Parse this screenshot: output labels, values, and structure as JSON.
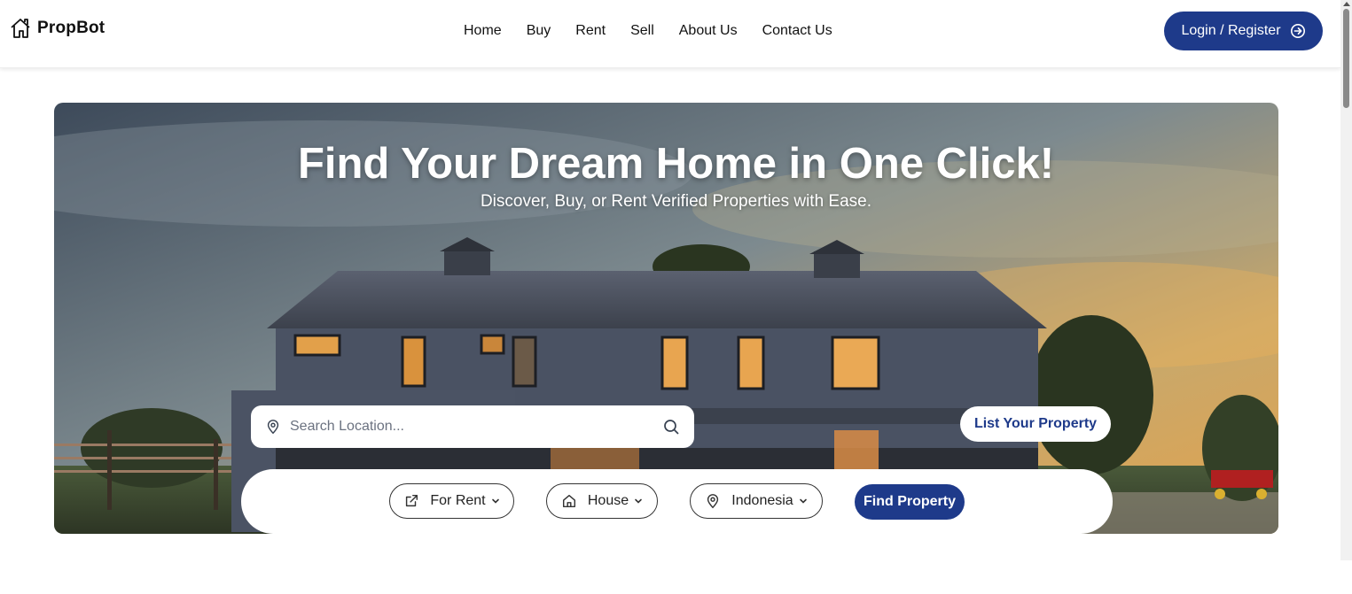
{
  "brand": {
    "name": "PropBot",
    "icon": "house-outline-icon"
  },
  "nav": {
    "items": [
      {
        "label": "Home"
      },
      {
        "label": "Buy"
      },
      {
        "label": "Rent"
      },
      {
        "label": "Sell"
      },
      {
        "label": "About Us"
      },
      {
        "label": "Contact Us"
      }
    ]
  },
  "auth": {
    "login_label": "Login / Register",
    "icon": "arrow-circle-right-icon"
  },
  "hero": {
    "title": "Find Your Dream Home in One Click!",
    "subtitle": "Discover, Buy, or Rent Verified Properties with Ease."
  },
  "search": {
    "placeholder": "Search Location...",
    "value": "",
    "left_icon": "map-pin-icon",
    "right_icon": "search-icon"
  },
  "list_property": {
    "label": "List Your Property"
  },
  "filters": {
    "listing_type": {
      "label": "For Rent",
      "icon": "external-link-icon"
    },
    "property_type": {
      "label": "House",
      "icon": "home-icon"
    },
    "country": {
      "label": "Indonesia",
      "icon": "map-pin-icon"
    },
    "submit_label": "Find Property"
  },
  "colors": {
    "primary": "#1e3a8a",
    "text": "#111111",
    "white": "#ffffff"
  }
}
